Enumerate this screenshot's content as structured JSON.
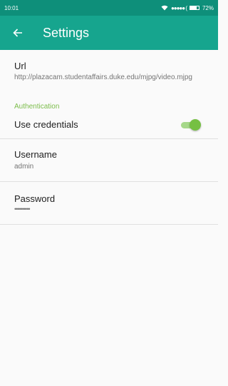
{
  "status_bar": {
    "time": "10:01",
    "battery_text": "72%",
    "battery_level": 0.72,
    "wifi_icon": "wifi-icon",
    "signal_dots": "●●●●● ("
  },
  "app_bar": {
    "back_icon": "arrow-left-icon",
    "title": "Settings",
    "background": "#16a58e",
    "status_background": "#0e8f7a"
  },
  "preferences": {
    "url": {
      "title": "Url",
      "summary": "http://plazacam.studentaffairs.duke.edu/mjpg/video.mjpg"
    },
    "authentication_category": "Authentication",
    "use_credentials": {
      "title": "Use credentials",
      "enabled": true
    },
    "username": {
      "title": "Username",
      "summary": "admin"
    },
    "password": {
      "title": "Password",
      "summary": "••••••••••"
    }
  },
  "colors": {
    "accent": "#76c043",
    "category_text": "#7cbd4b"
  }
}
